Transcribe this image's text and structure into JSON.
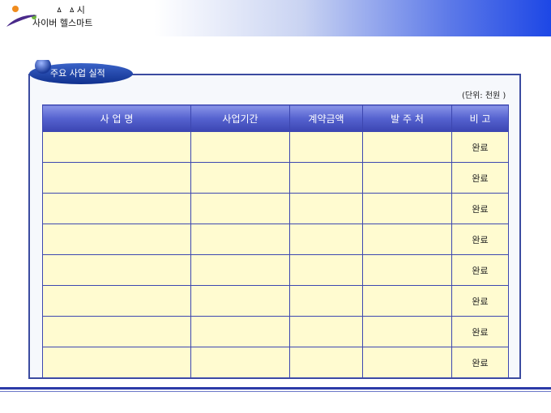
{
  "logo": {
    "line1": "ㅿ ㅿ시",
    "line2": "사이버 헬스마트"
  },
  "section_title": "주요 사업 실적",
  "unit_note": "(단위: 천원 )",
  "table": {
    "headers": [
      "사 업 명",
      "사업기간",
      "계약금액",
      "발 주 처",
      "비 고"
    ],
    "rows": [
      [
        "",
        "",
        "",
        "",
        "완료"
      ],
      [
        "",
        "",
        "",
        "",
        "완료"
      ],
      [
        "",
        "",
        "",
        "",
        "완료"
      ],
      [
        "",
        "",
        "",
        "",
        "완료"
      ],
      [
        "",
        "",
        "",
        "",
        "완료"
      ],
      [
        "",
        "",
        "",
        "",
        "완료"
      ],
      [
        "",
        "",
        "",
        "",
        "완료"
      ],
      [
        "",
        "",
        "",
        "",
        "완료"
      ]
    ]
  },
  "colors": {
    "header_gradient_end": "#1d47e6",
    "table_border": "#3d47b0",
    "cell_fill": "#fffbd0"
  }
}
